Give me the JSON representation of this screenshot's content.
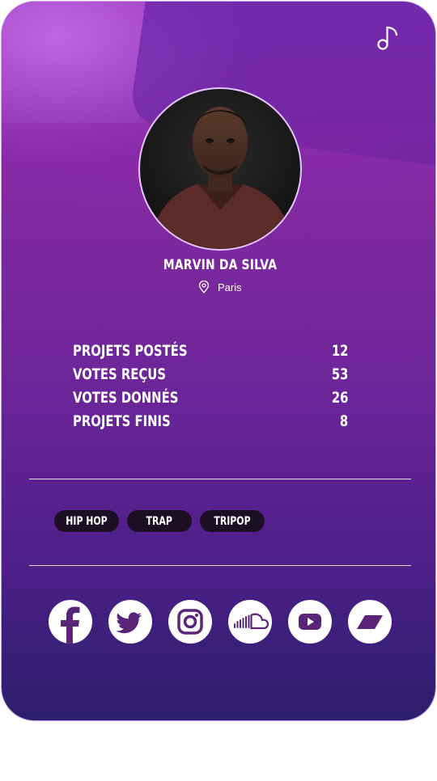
{
  "profile": {
    "name": "MARVIN DA SILVA",
    "location": "Paris"
  },
  "stats": [
    {
      "label": "PROJETS POSTÉS",
      "value": "12"
    },
    {
      "label": "VOTES REÇUS",
      "value": "53"
    },
    {
      "label": "VOTES DONNÉS",
      "value": "26"
    },
    {
      "label": "PROJETS FINIS",
      "value": "8"
    }
  ],
  "tags": [
    "HIP HOP",
    "TRAP",
    "TRIPOP"
  ],
  "socials": [
    "facebook-icon",
    "twitter-icon",
    "instagram-icon",
    "soundcloud-icon",
    "youtube-icon",
    "deezer-icon"
  ],
  "colors": {
    "accent": "#5a2478",
    "tag_bg": "#1c0f24"
  }
}
